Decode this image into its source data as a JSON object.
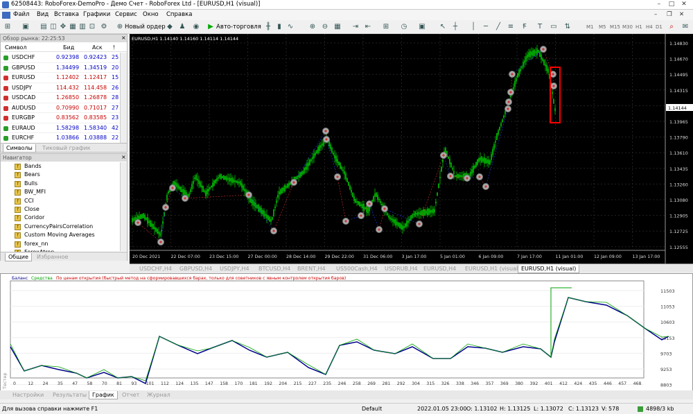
{
  "window": {
    "title": "62508443: RoboForex-DemoPro - Демо Счет - RoboForex Ltd - [EURUSD,H1 (visual)]"
  },
  "menu": [
    "Файл",
    "Вид",
    "Вставка",
    "Графики",
    "Сервис",
    "Окно",
    "Справка"
  ],
  "toolbar": {
    "new_order": "Новый ордер",
    "autotrading": "Авто-торговля",
    "timeframes": [
      "M1",
      "M5",
      "M15",
      "M30",
      "H1",
      "H4",
      "D1",
      "W1",
      "MN"
    ]
  },
  "market_watch": {
    "header": "Обзор рынка: 22:25:53",
    "columns": [
      "Символ",
      "Бид",
      "Аск",
      "!"
    ],
    "rows": [
      {
        "symbol": "USDCHF",
        "bid": "0.92398",
        "ask": "0.92423",
        "spread": "25",
        "dir": "up"
      },
      {
        "symbol": "GBPUSD",
        "bid": "1.34499",
        "ask": "1.34519",
        "spread": "20",
        "dir": "up"
      },
      {
        "symbol": "EURUSD",
        "bid": "1.12402",
        "ask": "1.12417",
        "spread": "15",
        "dir": "down"
      },
      {
        "symbol": "USDJPY",
        "bid": "114.432",
        "ask": "114.458",
        "spread": "26",
        "dir": "down"
      },
      {
        "symbol": "USDCAD",
        "bid": "1.26850",
        "ask": "1.26878",
        "spread": "28",
        "dir": "down"
      },
      {
        "symbol": "AUDUSD",
        "bid": "0.70990",
        "ask": "0.71017",
        "spread": "27",
        "dir": "down"
      },
      {
        "symbol": "EURGBP",
        "bid": "0.83562",
        "ask": "0.83585",
        "spread": "23",
        "dir": "down"
      },
      {
        "symbol": "EURAUD",
        "bid": "1.58298",
        "ask": "1.58340",
        "spread": "42",
        "dir": "up"
      },
      {
        "symbol": "EURCHF",
        "bid": "1.03866",
        "ask": "1.03888",
        "spread": "22",
        "dir": "up"
      }
    ],
    "tabs": [
      "Символы",
      "Тиковый график"
    ]
  },
  "navigator": {
    "header": "Навигатор",
    "items": [
      "Bands",
      "Bears",
      "Bulls",
      "BW_MFI",
      "CCI",
      "Close",
      "Coridor",
      "CurrencyPairsCorrelation",
      "Custom Moving Averages",
      "forex_nn",
      "ForexAtron"
    ],
    "tabs": [
      "Общие",
      "Избранное"
    ]
  },
  "chart": {
    "label": "EURUSD,H1  1.14140 1.14160 1.14114 1.14144",
    "price_ticks": [
      "1.14830",
      "1.14670",
      "1.14495",
      "1.14315",
      "1.14144",
      "1.13965",
      "1.13790",
      "1.13610",
      "1.13435",
      "1.13260",
      "1.13080",
      "1.12905",
      "1.12725",
      "1.12555"
    ],
    "current_price": "1.14144",
    "time_ticks": [
      "20 Dec 2021",
      "22 Dec 07:00",
      "23 Dec 15:00",
      "27 Dec 00:00",
      "28 Dec 14:00",
      "29 Dec 22:00",
      "31 Dec 06:00",
      "3 Jan 17:00",
      "5 Jan 01:00",
      "6 Jan 09:00",
      "7 Jan 17:00",
      "11 Jan 01:00",
      "12 Jan 09:00",
      "13 Jan 17:00"
    ],
    "tabs": [
      "USDCHF,H4",
      "GBPUSD,H4",
      "USDJPY,H4",
      "BTCUSD,H4",
      "BRENT,H4",
      "US500Cash,H4",
      "USDRUB,H4",
      "EURUSD,H4",
      "EURUSD,H1 (visual)",
      "EURUSD,H1 (visual)"
    ]
  },
  "tester": {
    "legend_balance": "Баланс",
    "legend_equity": "Средства",
    "legend_note": "По ценам открытия (быстрый метод на сформировавшихся барах, только для советников с явным контролем открытия баров)",
    "y_ticks": [
      "11503",
      "11053",
      "10603",
      "10153",
      "9703",
      "9253",
      "8803"
    ],
    "x_ticks": [
      "0",
      "12",
      "24",
      "35",
      "47",
      "58",
      "70",
      "81",
      "93",
      "101",
      "112",
      "124",
      "135",
      "147",
      "158",
      "170",
      "181",
      "192",
      "204",
      "215",
      "227",
      "235",
      "246",
      "258",
      "269",
      "281",
      "292",
      "304",
      "315",
      "326",
      "338",
      "346",
      "357",
      "369",
      "380",
      "392",
      "401",
      "412",
      "424",
      "435",
      "446",
      "457",
      "468"
    ],
    "side_label": "Тестер",
    "tabs": [
      "Настройки",
      "Результаты",
      "График",
      "Отчет",
      "Журнал"
    ]
  },
  "status": {
    "help": "Для вызова справки нажмите F1",
    "profile": "Default",
    "datetime": "2022.01.05 23:00",
    "open": "O: 1.13102",
    "high": "H: 1.13125",
    "low": "L: 1.13072",
    "close": "C: 1.13123",
    "volume": "V: 578",
    "traffic": "4898/3 kb"
  },
  "colors": {
    "candle": "#00c800",
    "balance": "#00008b",
    "equity": "#00a000",
    "highlight": "#ff0000"
  }
}
